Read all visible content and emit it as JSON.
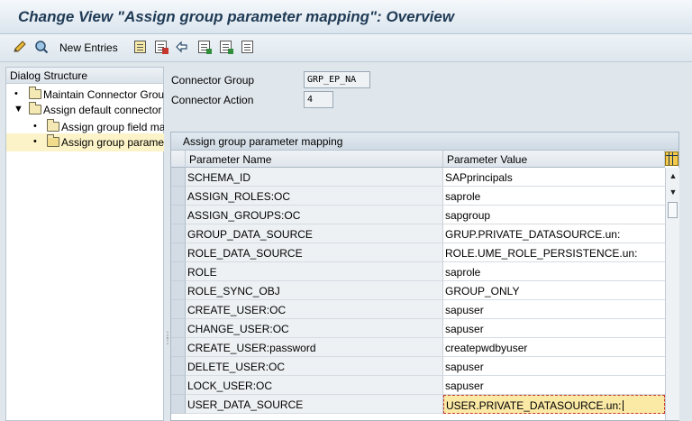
{
  "title": "Change View \"Assign group parameter mapping\": Overview",
  "toolbar": {
    "new_entries": "New Entries",
    "icons": [
      "edit-pencil-icon",
      "display-change-icon",
      "copy-icon",
      "delete-icon",
      "undo-icon",
      "select-all-icon",
      "select-block-icon",
      "deselect-all-icon"
    ]
  },
  "dialog": {
    "header": "Dialog Structure",
    "items": [
      {
        "label": "Maintain Connector Grou"
      },
      {
        "label": "Assign default connector"
      },
      {
        "label": "Assign group field ma"
      },
      {
        "label": "Assign group parame"
      }
    ]
  },
  "fields": {
    "group_label": "Connector Group",
    "group_value": "GRP_EP_NA",
    "action_label": "Connector Action",
    "action_value": "4"
  },
  "table": {
    "title": "Assign group parameter mapping",
    "columns": [
      "Parameter Name",
      "Parameter Value"
    ],
    "rows": [
      {
        "name": "SCHEMA_ID",
        "value": "SAPprincipals"
      },
      {
        "name": "ASSIGN_ROLES:OC",
        "value": "saprole"
      },
      {
        "name": "ASSIGN_GROUPS:OC",
        "value": "sapgroup"
      },
      {
        "name": "GROUP_DATA_SOURCE",
        "value": "GRUP.PRIVATE_DATASOURCE.un:"
      },
      {
        "name": "ROLE_DATA_SOURCE",
        "value": "ROLE.UME_ROLE_PERSISTENCE.un:"
      },
      {
        "name": "ROLE",
        "value": "saprole"
      },
      {
        "name": "ROLE_SYNC_OBJ",
        "value": "GROUP_ONLY"
      },
      {
        "name": "CREATE_USER:OC",
        "value": "sapuser"
      },
      {
        "name": "CHANGE_USER:OC",
        "value": "sapuser"
      },
      {
        "name": "CREATE_USER:password",
        "value": "createpwdbyuser"
      },
      {
        "name": "DELETE_USER:OC",
        "value": "sapuser"
      },
      {
        "name": "LOCK_USER:OC",
        "value": "sapuser"
      },
      {
        "name": "USER_DATA_SOURCE",
        "value": "USER.PRIVATE_DATASOURCE.un:"
      }
    ]
  }
}
